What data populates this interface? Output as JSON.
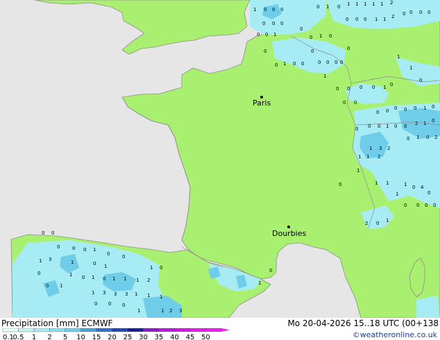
{
  "map": {
    "cities": [
      {
        "name": "Paris"
      },
      {
        "name": "Dourbies"
      }
    ],
    "precip_labels": [
      "1",
      "0",
      "0",
      "0",
      "0",
      "0",
      "0",
      "0",
      "0",
      "1",
      "0",
      "1",
      "0",
      "1",
      "1",
      "1",
      "1",
      "1",
      "2",
      "0",
      "0",
      "0",
      "1",
      "1",
      "2",
      "0",
      "0",
      "0",
      "0",
      "0",
      "0",
      "1",
      "0",
      "0",
      "0",
      "1",
      "0",
      "0",
      "0",
      "0",
      "0",
      "0",
      "0",
      "0",
      "1",
      "1",
      "0",
      "1",
      "0",
      "0",
      "0",
      "0",
      "1",
      "0",
      "0",
      "0",
      "0",
      "0",
      "0",
      "0",
      "0",
      "1",
      "0",
      "0",
      "0",
      "1",
      "0",
      "0",
      "2",
      "1",
      "0",
      "0",
      "0",
      "1",
      "0",
      "2",
      "1",
      "3",
      "2",
      "1",
      "1",
      "2",
      "1",
      "0",
      "1",
      "1",
      "1",
      "0",
      "4",
      "0",
      "1",
      "0",
      "0",
      "0",
      "0",
      "2",
      "0",
      "1",
      "0",
      "0",
      "1",
      "3",
      "0",
      "0",
      "0",
      "1",
      "0",
      "1",
      "0",
      "1",
      "0",
      "1",
      "0",
      "0",
      "1",
      "0",
      "1",
      "1",
      "1",
      "2",
      "0",
      "1",
      "0",
      "1",
      "1",
      "3",
      "3",
      "3",
      "1",
      "1",
      "1",
      "0",
      "0",
      "0",
      "1",
      "1",
      "2",
      "3",
      "1",
      "1",
      "0",
      "1",
      "0",
      "0",
      "0",
      "1",
      "0",
      "2",
      "3",
      "0",
      "0"
    ]
  },
  "footer": {
    "title": "Precipitation [mm] ECMWF",
    "time": "Mo 20-04-2026 15..18 UTC (00+138",
    "credit": "©weatheronline.co.uk",
    "scale": {
      "ticks": [
        "0.1",
        "0.5",
        "1",
        "2",
        "5",
        "10",
        "15",
        "20",
        "25",
        "30",
        "35",
        "40",
        "45",
        "50"
      ],
      "colors": [
        "#e8fffe",
        "#c2f5fa",
        "#a7ebf4",
        "#8cdfef",
        "#6fcdea",
        "#4aa0d7",
        "#3470c4",
        "#1e48b0",
        "#1c1c9a",
        "#8a1cc8",
        "#b41cd8",
        "#cf1ce0",
        "#e61ce8",
        "#f01cf0"
      ]
    }
  }
}
